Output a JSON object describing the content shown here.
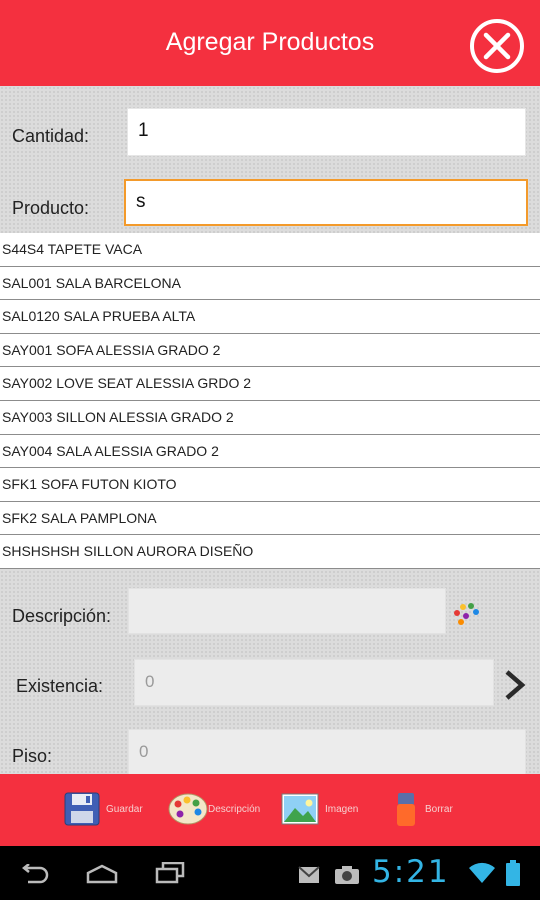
{
  "header": {
    "title": "Agregar Productos",
    "close_icon": "close-circle-icon"
  },
  "form": {
    "cantidad_label": "Cantidad:",
    "cantidad_value": "1",
    "producto_label": "Producto:",
    "producto_value": "s",
    "descripcion_label": "Descripción:",
    "descripcion_value": "",
    "existencia_label": "Existencia:",
    "existencia_value": "0",
    "piso_label": "Piso:",
    "piso_value": "0"
  },
  "suggestions": [
    "S44S4 TAPETE VACA",
    "SAL001 SALA BARCELONA",
    "SAL0120 SALA PRUEBA ALTA",
    "SAY001 SOFA ALESSIA GRADO 2",
    "SAY002 LOVE SEAT ALESSIA GRDO 2",
    "SAY003 SILLON ALESSIA GRADO 2",
    "SAY004 SALA ALESSIA GRADO 2",
    "SFK1 SOFA FUTON KIOTO",
    "SFK2 SALA PAMPLONA",
    "SHSHSHSH SILLON AURORA DISEÑO"
  ],
  "bottom_bar": {
    "guardar": "Guardar",
    "descripcion": "Descripción",
    "imagen": "Imagen",
    "borrar": "Borrar"
  },
  "status_bar": {
    "time": "5:21"
  },
  "colors": {
    "accent": "#f4303f",
    "focus": "#f39a2b",
    "clock": "#33b5e5"
  }
}
